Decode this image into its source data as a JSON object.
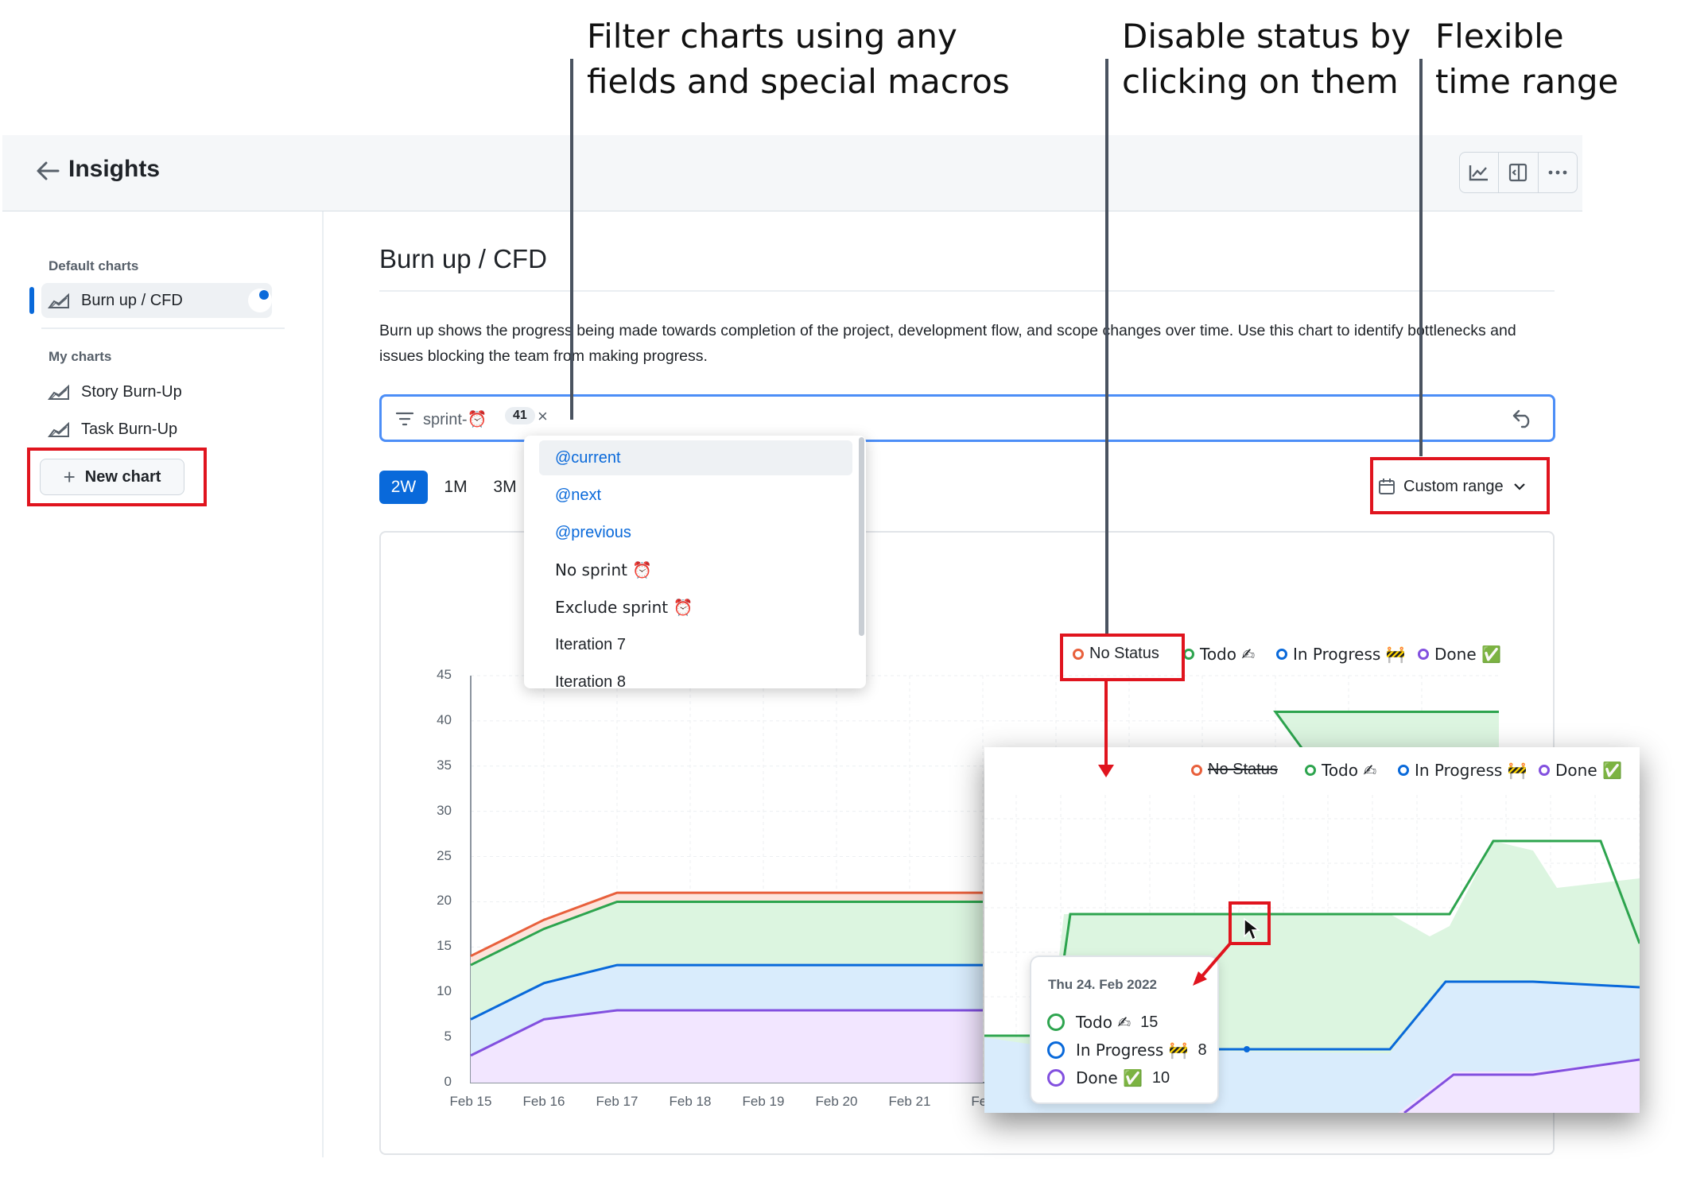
{
  "annotations": {
    "filter_line1": "Filter charts using any",
    "filter_line2": "fields and special macros",
    "status_line1": "Disable status by",
    "status_line2": "clicking on them",
    "range_line1": "Flexible",
    "range_line2": "time range"
  },
  "header": {
    "title": "Insights",
    "actions": [
      "line-chart-icon",
      "panel-icon",
      "more-icon"
    ]
  },
  "sidebar": {
    "default_heading": "Default charts",
    "default_items": [
      {
        "label": "Burn up / CFD",
        "active": true
      }
    ],
    "my_heading": "My charts",
    "my_items": [
      {
        "label": "Story Burn-Up"
      },
      {
        "label": "Task Burn-Up"
      }
    ],
    "new_chart": "New chart"
  },
  "main": {
    "title": "Burn up / CFD",
    "description": "Burn up shows the progress being made towards completion of the project, development flow, and scope changes over time. Use this chart to identify bottlenecks and issues blocking the team from making progress.",
    "filter": {
      "value": "sprint-⏰",
      "count": "41",
      "clear": "×"
    },
    "ranges": [
      "2W",
      "1M",
      "3M"
    ],
    "selected_range": "2W",
    "custom_range": "Custom range"
  },
  "dropdown": {
    "items": [
      {
        "label": "@current",
        "macro": true,
        "highlighted": true
      },
      {
        "label": "@next",
        "macro": true
      },
      {
        "label": "@previous",
        "macro": true
      },
      {
        "label": "No sprint ⏰",
        "macro": false
      },
      {
        "label": "Exclude sprint ⏰",
        "macro": false
      },
      {
        "label": "Iteration 7",
        "macro": false
      },
      {
        "label": "Iteration 8",
        "macro": false
      }
    ]
  },
  "legend": [
    {
      "label": "No Status",
      "color": "#e8603c"
    },
    {
      "label": "Todo ✍",
      "color": "#2da44e"
    },
    {
      "label": "In Progress 🚧",
      "color": "#0969da"
    },
    {
      "label": "Done ✅",
      "color": "#8250df"
    }
  ],
  "zoom_legend": [
    {
      "label": "No Status",
      "color": "#e8603c",
      "disabled": true
    },
    {
      "label": "Todo ✍",
      "color": "#2da44e"
    },
    {
      "label": "In Progress 🚧",
      "color": "#0969da"
    },
    {
      "label": "Done ✅",
      "color": "#8250df"
    }
  ],
  "tooltip": {
    "date": "Thu 24. Feb 2022",
    "rows": [
      {
        "label": "Todo ✍",
        "value": "15",
        "color": "#2da44e"
      },
      {
        "label": "In Progress 🚧",
        "value": "8",
        "color": "#0969da"
      },
      {
        "label": "Done ✅",
        "value": "10",
        "color": "#8250df"
      }
    ]
  },
  "colors": {
    "accent": "#0969da",
    "annotation_box": "#e0141e",
    "no_status": "#e8603c",
    "todo": "#2da44e",
    "in_progress": "#0969da",
    "done": "#8250df"
  },
  "chart_data": {
    "type": "area",
    "categories": [
      "Feb 15",
      "Feb 16",
      "Feb 17",
      "Feb 18",
      "Feb 19",
      "Feb 20",
      "Feb 21",
      "Feb"
    ],
    "yticks": [
      0,
      5,
      10,
      15,
      20,
      25,
      30,
      35,
      40,
      45
    ],
    "ylim": [
      0,
      45
    ],
    "stacked": true,
    "series": [
      {
        "name": "Done ✅",
        "color": "#8250df",
        "values": [
          3,
          7,
          8,
          8,
          8,
          8,
          8,
          8
        ]
      },
      {
        "name": "In Progress 🚧",
        "color": "#0969da",
        "values": [
          7,
          11,
          13,
          13,
          13,
          13,
          13,
          13
        ]
      },
      {
        "name": "Todo ✍",
        "color": "#2da44e",
        "values": [
          13,
          17,
          20,
          20,
          20,
          20,
          20,
          20
        ]
      },
      {
        "name": "No Status",
        "color": "#e8603c",
        "values": [
          14,
          18,
          21,
          21,
          21,
          21,
          21,
          21
        ]
      }
    ],
    "visible_top_right_cumulative": [
      [
        11,
        41
      ],
      [
        11.6,
        41
      ],
      [
        12.5,
        41
      ]
    ]
  }
}
